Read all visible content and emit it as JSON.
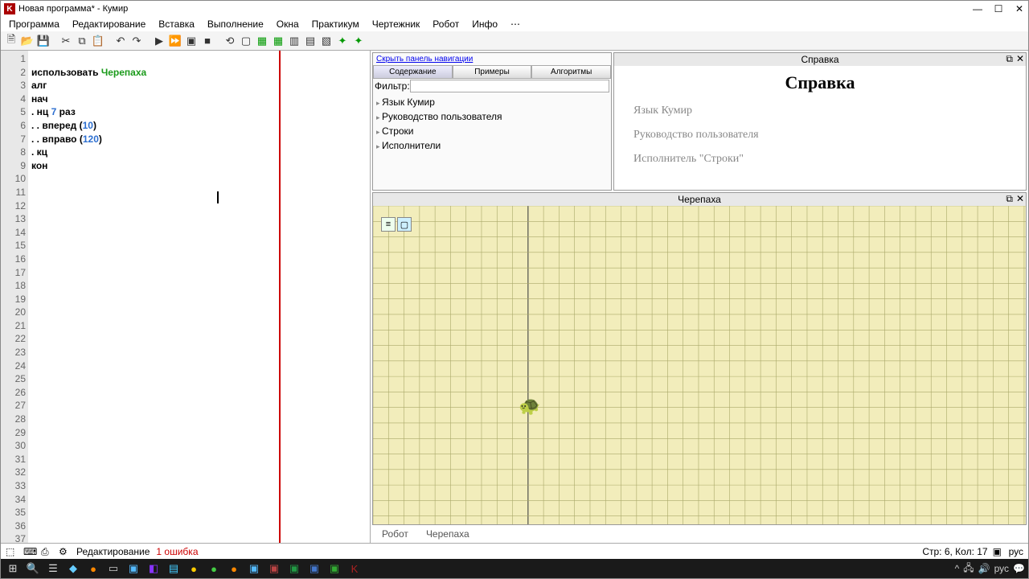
{
  "window": {
    "title": "Новая программа* - Кумир",
    "app_icon_letter": "K"
  },
  "menu": [
    "Программа",
    "Редактирование",
    "Вставка",
    "Выполнение",
    "Окна",
    "Практикум",
    "Чертежник",
    "Робот",
    "Инфо",
    "⋯"
  ],
  "toolbar": {
    "items": [
      {
        "name": "new-icon",
        "glyph": "🗎"
      },
      {
        "name": "open-icon",
        "glyph": "📂"
      },
      {
        "name": "save-icon",
        "glyph": "💾"
      },
      {
        "name": "sep"
      },
      {
        "name": "cut-icon",
        "glyph": "✂"
      },
      {
        "name": "copy-icon",
        "glyph": "⧉"
      },
      {
        "name": "paste-icon",
        "glyph": "📋"
      },
      {
        "name": "sep"
      },
      {
        "name": "undo-icon",
        "glyph": "↶"
      },
      {
        "name": "redo-icon",
        "glyph": "↷"
      },
      {
        "name": "sep"
      },
      {
        "name": "run-icon",
        "glyph": "▶"
      },
      {
        "name": "run-fast-icon",
        "glyph": "⏩"
      },
      {
        "name": "step-icon",
        "glyph": "▣"
      },
      {
        "name": "stop-icon",
        "glyph": "■"
      },
      {
        "name": "sep"
      },
      {
        "name": "reload-icon",
        "glyph": "⟲"
      },
      {
        "name": "placeholder-icon",
        "glyph": "▢"
      },
      {
        "name": "green1-icon",
        "glyph": "▦",
        "green": true
      },
      {
        "name": "green2-icon",
        "glyph": "▦",
        "green": true
      },
      {
        "name": "panel1-icon",
        "glyph": "▥"
      },
      {
        "name": "panel2-icon",
        "glyph": "▤"
      },
      {
        "name": "panel3-icon",
        "glyph": "▧"
      },
      {
        "name": "bug1-icon",
        "glyph": "✦",
        "green": true
      },
      {
        "name": "bug2-icon",
        "glyph": "✦",
        "green": true
      }
    ]
  },
  "editor": {
    "total_lines": 37,
    "code": {
      "l1_kw": "использовать ",
      "l1_mod": "Черепаха",
      "l2": "алг",
      "l3": "нач",
      "l4_a": ". нц ",
      "l4_n": "7",
      "l4_b": " раз",
      "l5_a": ". . вперед (",
      "l5_n": "10",
      "l5_b": ")",
      "l6_a": ". . вправо (",
      "l6_n": "120",
      "l6_b": ")",
      "l7": ". кц",
      "l8": "кон"
    }
  },
  "help_pane": {
    "title": "Справка",
    "hide_link": "Скрыть панель навигации",
    "tabs": [
      "Содержание",
      "Примеры",
      "Алгоритмы"
    ],
    "filter_label": "Фильтр:",
    "tree": [
      "Язык Кумир",
      "Руководство пользователя",
      "Строки",
      "Исполнители"
    ],
    "content_title": "Справка",
    "links": [
      "Язык Кумир",
      "Руководство пользователя",
      "Исполнитель \"Строки\""
    ]
  },
  "turtle_pane": {
    "title": "Черепаха",
    "turtle_emoji": "🐢"
  },
  "exec_tabs": [
    "Робот",
    "Черепаха"
  ],
  "statusbar": {
    "mode": "Редактирование",
    "errors": "1 ошибка",
    "position": "Стр: 6, Кол: 17"
  },
  "taskbar": {
    "time": "",
    "lang": "рус"
  }
}
